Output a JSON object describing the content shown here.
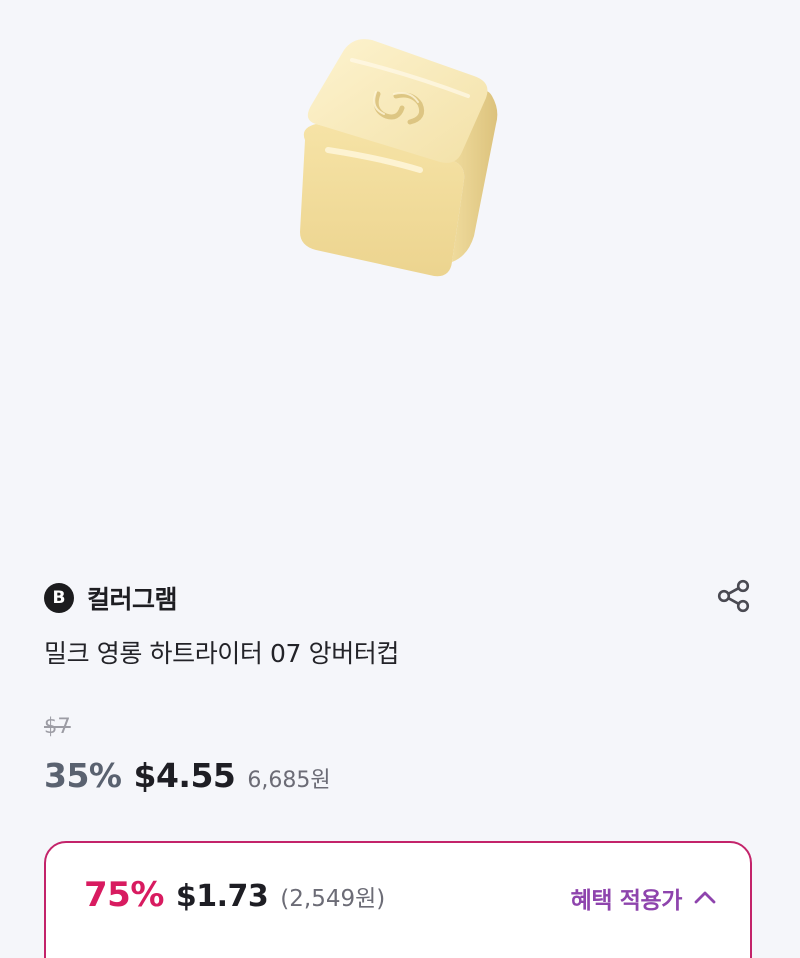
{
  "product": {
    "brand_badge": "B",
    "brand_name": "컬러그램",
    "name": "밀크 영롱 하트라이터 07 앙버터컵",
    "image_icon": "product-photo"
  },
  "pricing": {
    "original_price": "$7",
    "discount_rate": "35%",
    "sale_price": "$4.55",
    "sale_price_won": "6,685원"
  },
  "benefit": {
    "discount_rate": "75%",
    "price": "$1.73",
    "price_won": "(2,549원)",
    "toggle_label": "혜택 적용가",
    "toggle_icon": "chevron-up-icon"
  },
  "icons": {
    "share": "share-icon"
  },
  "colors": {
    "background": "#f5f6fa",
    "accent_pink": "#d81b60",
    "card_border": "#c3236a",
    "accent_purple": "#8e44ad",
    "discount_gray": "#5a6270"
  }
}
